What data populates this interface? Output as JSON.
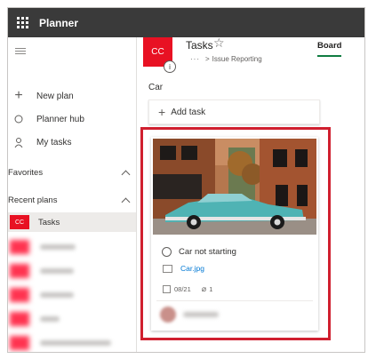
{
  "app": {
    "title": "Planner"
  },
  "nav": {
    "items": [
      {
        "label": "New plan",
        "icon": "plus-icon"
      },
      {
        "label": "Planner hub",
        "icon": "circle-icon"
      },
      {
        "label": "My tasks",
        "icon": "person-icon"
      }
    ],
    "favorites_label": "Favorites",
    "recent_label": "Recent plans",
    "recent_plans": [
      {
        "badge": "CC",
        "label": "Tasks",
        "active": true
      }
    ]
  },
  "plan": {
    "logo_initials": "CC",
    "info_icon_glyph": "i",
    "title": "Tasks",
    "breadcrumb_dots": "···",
    "breadcrumb_sep": ">",
    "breadcrumb_group": "Issue Reporting",
    "view_tab": "Board"
  },
  "bucket": {
    "name": "Car",
    "add_task_label": "Add task"
  },
  "card": {
    "task_name": "Car not starting",
    "attachment_name": "Car.jpg",
    "due_date": "08/21",
    "attachment_count": "1"
  },
  "colors": {
    "accent": "#e81123",
    "highlight": "#d01f2f",
    "topbar": "#3a3a3a",
    "tab_underline": "#107c41"
  }
}
